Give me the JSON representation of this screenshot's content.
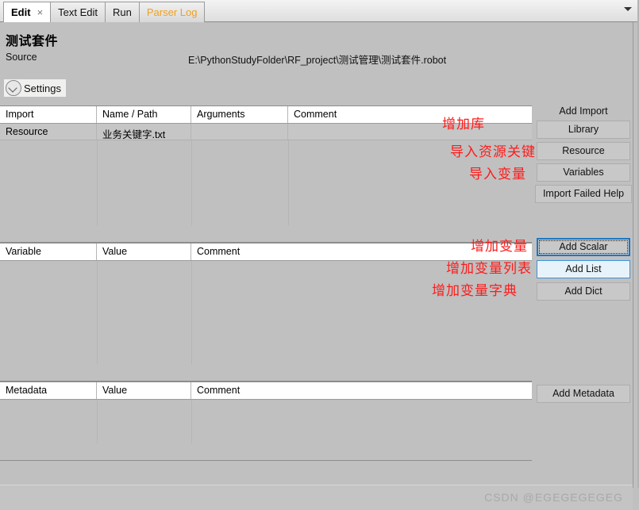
{
  "tabbar": {
    "tabs": [
      {
        "label": "Edit",
        "active": true,
        "closable": true,
        "orange": false
      },
      {
        "label": "Text Edit",
        "active": false,
        "closable": false,
        "orange": false
      },
      {
        "label": "Run",
        "active": false,
        "closable": false,
        "orange": false
      },
      {
        "label": "Parser Log",
        "active": false,
        "closable": false,
        "orange": true
      }
    ],
    "close_glyph": "×",
    "overflow_icon": "chevron-down-icon"
  },
  "header": {
    "title": "测试套件",
    "source_label": "Source",
    "source_value": "E:\\PythonStudyFolder\\RF_project\\测试管理\\测试套件.robot",
    "settings_label": "Settings"
  },
  "import_table": {
    "columns": [
      "Import",
      "Name / Path",
      "Arguments",
      "Comment"
    ],
    "rows": [
      [
        "Resource",
        "业务关键字.txt",
        "",
        ""
      ]
    ]
  },
  "variable_table": {
    "columns": [
      "Variable",
      "Value",
      "Comment"
    ],
    "rows": []
  },
  "metadata_table": {
    "columns": [
      "Metadata",
      "Value",
      "Comment"
    ],
    "rows": []
  },
  "import_panel": {
    "title": "Add Import",
    "buttons": [
      {
        "label": "Library",
        "state": "normal"
      },
      {
        "label": "Resource",
        "state": "normal"
      },
      {
        "label": "Variables",
        "state": "normal"
      },
      {
        "label": "Import Failed Help",
        "state": "normal"
      }
    ]
  },
  "variable_panel": {
    "buttons": [
      {
        "label": "Add Scalar",
        "state": "focused"
      },
      {
        "label": "Add List",
        "state": "hover"
      },
      {
        "label": "Add Dict",
        "state": "normal"
      }
    ]
  },
  "metadata_panel": {
    "buttons": [
      {
        "label": "Add Metadata",
        "state": "normal"
      }
    ]
  },
  "annotations": [
    {
      "text": "增加库"
    },
    {
      "text": "导入资源关键字"
    },
    {
      "text": "导入变量"
    },
    {
      "text": "增加变量"
    },
    {
      "text": "增加变量列表"
    },
    {
      "text": "增加变量字典"
    }
  ],
  "footer": {
    "watermark": "CSDN @EGEGEGEGEG"
  },
  "colors": {
    "accent_blue": "#1d77c4",
    "hover_blue": "#e7f3fb",
    "annotation_red": "#ff1a1a",
    "tab_orange": "#f0a020",
    "panel_gray": "#c0c0c0"
  }
}
